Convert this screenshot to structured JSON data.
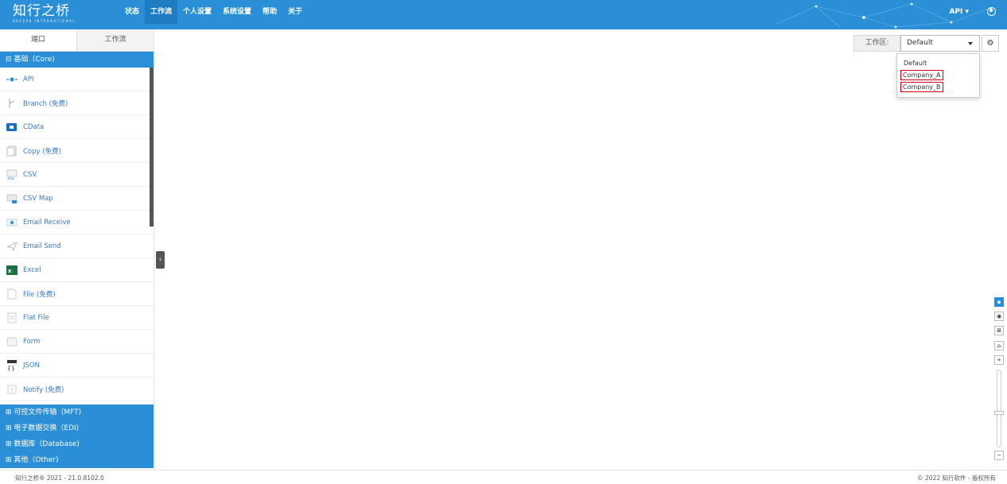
{
  "header": {
    "logo_text": "知行之桥",
    "logo_sub": "ARCESB INTERNATIONAL",
    "nav": [
      {
        "label": "状态",
        "active": false
      },
      {
        "label": "工作流",
        "active": true
      },
      {
        "label": "个人设置",
        "active": false
      },
      {
        "label": "系统设置",
        "active": false
      },
      {
        "label": "帮助",
        "active": false
      },
      {
        "label": "关于",
        "active": false
      }
    ],
    "api_menu": "API ▾"
  },
  "sidebar": {
    "tabs": [
      "端口",
      "工作流"
    ],
    "core_group": "⊟ 基础（Core)",
    "items": [
      {
        "label": "API",
        "icon": "api-icon"
      },
      {
        "label": "Branch (免费)",
        "icon": "branch-icon"
      },
      {
        "label": "CData",
        "icon": "cdata-icon"
      },
      {
        "label": "Copy (免费)",
        "icon": "copy-icon"
      },
      {
        "label": "CSV",
        "icon": "csv-icon"
      },
      {
        "label": "CSV Map",
        "icon": "csv-map-icon"
      },
      {
        "label": "Email Receive",
        "icon": "email-receive-icon"
      },
      {
        "label": "Email Send",
        "icon": "email-send-icon"
      },
      {
        "label": "Excel",
        "icon": "excel-icon"
      },
      {
        "label": "File (免费)",
        "icon": "file-icon"
      },
      {
        "label": "Flat File",
        "icon": "flat-file-icon"
      },
      {
        "label": "Form",
        "icon": "form-icon"
      },
      {
        "label": "JSON",
        "icon": "json-icon"
      },
      {
        "label": "Notify (免费)",
        "icon": "notify-icon"
      }
    ],
    "other_groups": [
      "⊞ 可控文件传输（MFT)",
      "⊞ 电子数据交换（EDI)",
      "⊞ 数据库（Database)",
      "⊞ 其他（Other)"
    ]
  },
  "workspace": {
    "label": "工作区:",
    "selected": "Default",
    "options": [
      "Default",
      "Company_A",
      "Company_B"
    ]
  },
  "footer": {
    "left": "知行之桥® 2021 - 21.0.8102.0",
    "right": "© 2022 知行软件 - 版权所有"
  },
  "colors": {
    "primary": "#2a8fd6",
    "highlight": "#d0021b"
  }
}
